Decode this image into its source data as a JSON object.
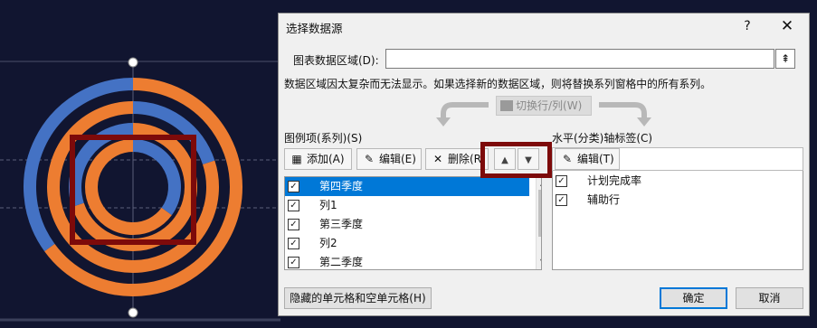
{
  "dialog": {
    "title": "选择数据源",
    "help": "?",
    "close": "✕",
    "range_label": "图表数据区域(D):",
    "range_value": "",
    "info": "数据区域因太复杂而无法显示。如果选择新的数据区域，则将替换系列窗格中的所有系列。",
    "switch_label": "切换行/列(W)",
    "legend_label": "图例项(系列)(S)",
    "axis_label": "水平(分类)轴标签(C)",
    "toolbar": {
      "add": "添加(A)",
      "edit": "编辑(E)",
      "delete": "删除(R)",
      "up": "▲",
      "down": "▼",
      "axis_edit": "编辑(T)"
    },
    "series": [
      {
        "label": "第四季度",
        "checked": true,
        "selected": true
      },
      {
        "label": "列1",
        "checked": true,
        "selected": false
      },
      {
        "label": "第三季度",
        "checked": true,
        "selected": false
      },
      {
        "label": "列2",
        "checked": true,
        "selected": false
      },
      {
        "label": "第二季度",
        "checked": true,
        "selected": false
      }
    ],
    "axis_items": [
      {
        "label": "计划完成率",
        "checked": true
      },
      {
        "label": "辅助行",
        "checked": true
      }
    ],
    "hidden_cells": "隐藏的单元格和空单元格(H)",
    "ok": "确定",
    "cancel": "取消"
  },
  "colors": {
    "slide_bg": "#111530",
    "orange": "#ed7d31",
    "blue": "#4472c4",
    "highlight": "#7d0a0a",
    "selection": "#0078d7"
  },
  "chart_data": {
    "type": "doughnut",
    "series": [
      {
        "values": [
          65,
          35
        ]
      },
      {
        "values": [
          20,
          80
        ]
      },
      {
        "values": [
          70,
          30
        ]
      },
      {
        "values": [
          35,
          65
        ]
      }
    ]
  }
}
